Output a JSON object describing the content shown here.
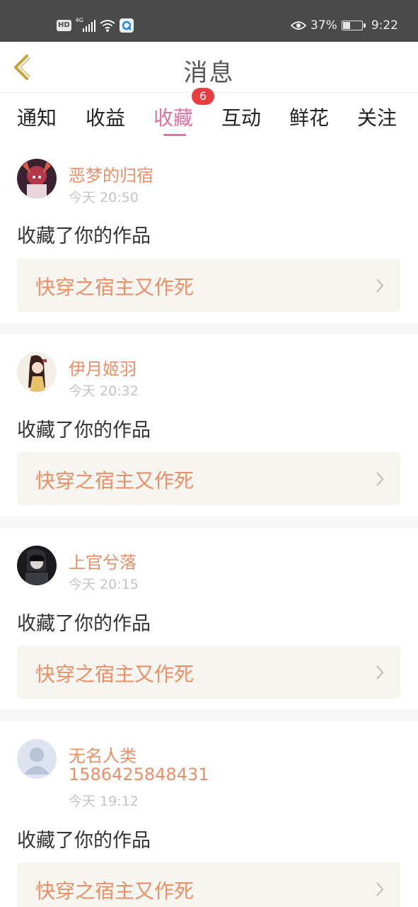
{
  "status_bar": {
    "hd_label": "HD",
    "network": "4G",
    "battery": "37%",
    "battery_level": 0.37,
    "time": "9:22"
  },
  "header": {
    "title": "消息",
    "back_icon": "chevron-left-icon"
  },
  "tabs": [
    {
      "label": "通知"
    },
    {
      "label": "收益"
    },
    {
      "label": "收藏",
      "active": true,
      "badge": "6"
    },
    {
      "label": "互动"
    },
    {
      "label": "鲜花"
    },
    {
      "label": "关注"
    }
  ],
  "colors": {
    "accent_pink": "#e071a0",
    "name_orange": "#ec8f66",
    "badge_red": "#ea3d41",
    "work_bg": "#f6f5f0",
    "status_bar_bg": "#4a4a4a"
  },
  "messages": [
    {
      "name": "恶梦的归宿",
      "time": "今天 20:50",
      "text": "收藏了你的作品",
      "work": "快穿之宿主又作死"
    },
    {
      "name": "伊月姬羽",
      "time": "今天 20:32",
      "text": "收藏了你的作品",
      "work": "快穿之宿主又作死"
    },
    {
      "name": "上官兮落",
      "time": "今天 20:15",
      "text": "收藏了你的作品",
      "work": "快穿之宿主又作死"
    },
    {
      "name": "无名人类",
      "name_line2": "1586425848431",
      "time": "今天 19:12",
      "text": "收藏了你的作品",
      "work": "快穿之宿主又作死"
    }
  ]
}
